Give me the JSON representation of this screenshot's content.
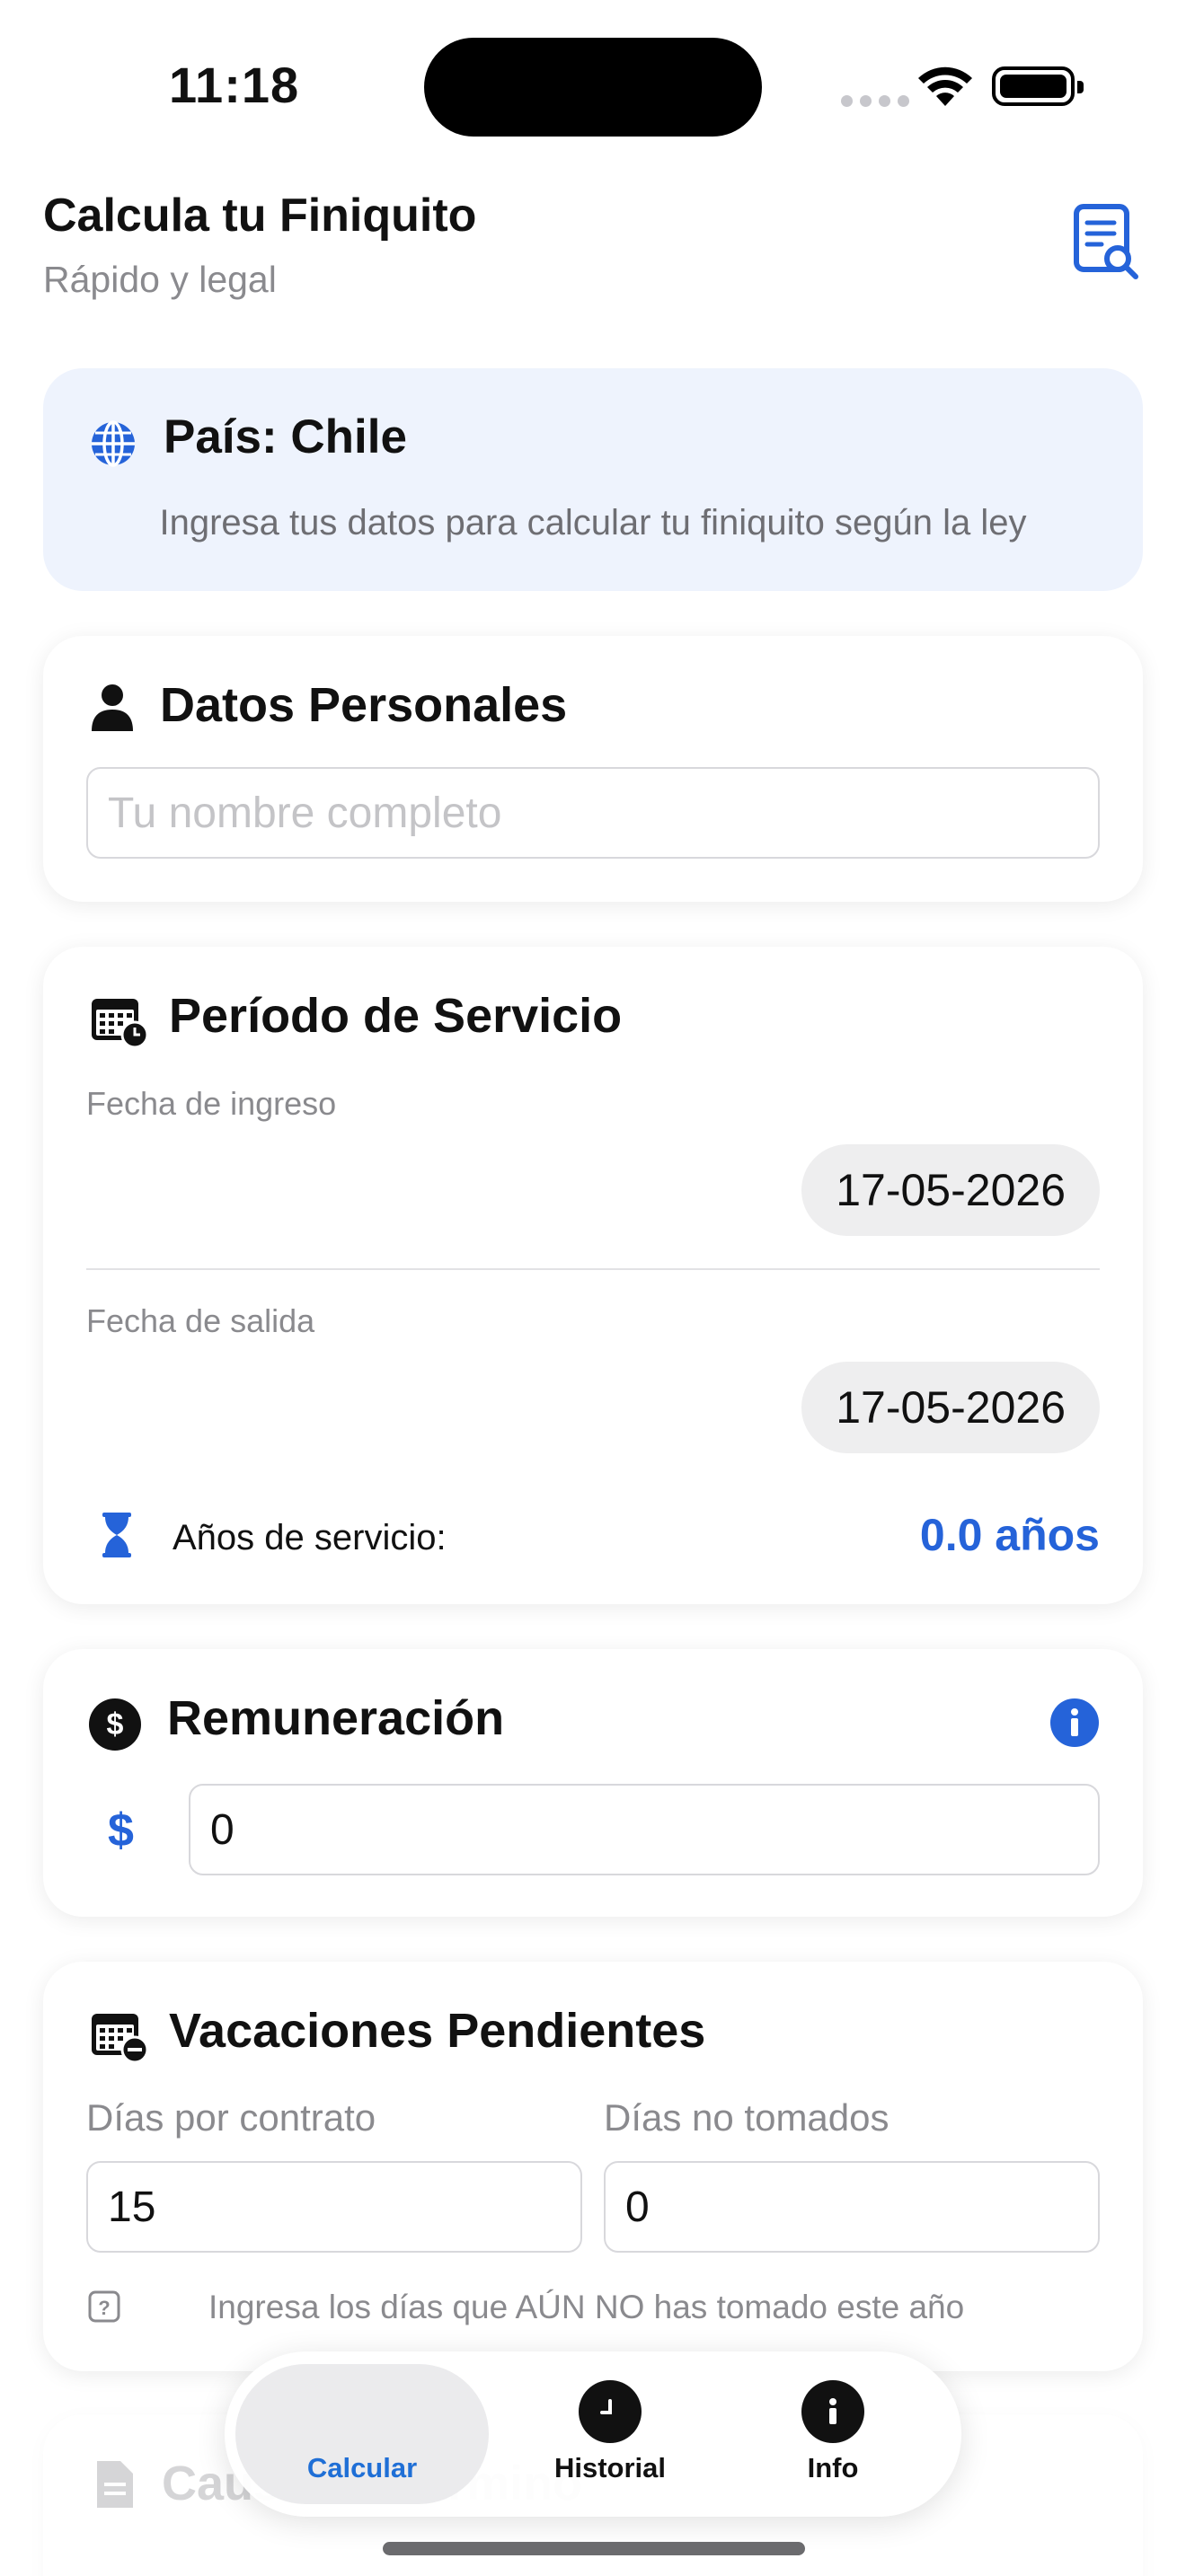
{
  "status_bar": {
    "time": "11:18"
  },
  "header": {
    "title": "Calcula tu Finiquito",
    "subtitle": "Rápido y legal"
  },
  "country_card": {
    "title": "País: Chile",
    "description": "Ingresa tus datos para calcular tu finiquito según la ley"
  },
  "personal": {
    "title": "Datos Personales",
    "name_placeholder": "Tu nombre completo",
    "name_value": ""
  },
  "service": {
    "title": "Período de Servicio",
    "start_label": "Fecha de ingreso",
    "start_value": "17-05-2026",
    "end_label": "Fecha de salida",
    "end_value": "17-05-2026",
    "years_label": "Años de servicio:",
    "years_value": "0.0 años"
  },
  "salary": {
    "title": "Remuneración",
    "currency_symbol": "$",
    "value": "0"
  },
  "vacations": {
    "title": "Vacaciones Pendientes",
    "contract_label": "Días por contrato",
    "contract_value": "15",
    "untaken_label": "Días no tomados",
    "untaken_value": "0",
    "help_text": "Ingresa los días que AÚN NO has tomado este año"
  },
  "next_section": {
    "title": "Causal de término"
  },
  "tabs": [
    {
      "label": "Calcular",
      "icon": "calculator-icon",
      "active": true
    },
    {
      "label": "Historial",
      "icon": "clock-icon",
      "active": false
    },
    {
      "label": "Info",
      "icon": "info-icon",
      "active": false
    }
  ],
  "colors": {
    "accent": "#2563d9",
    "country_bg": "#eef3fd",
    "text_muted": "#8a8a8e"
  }
}
